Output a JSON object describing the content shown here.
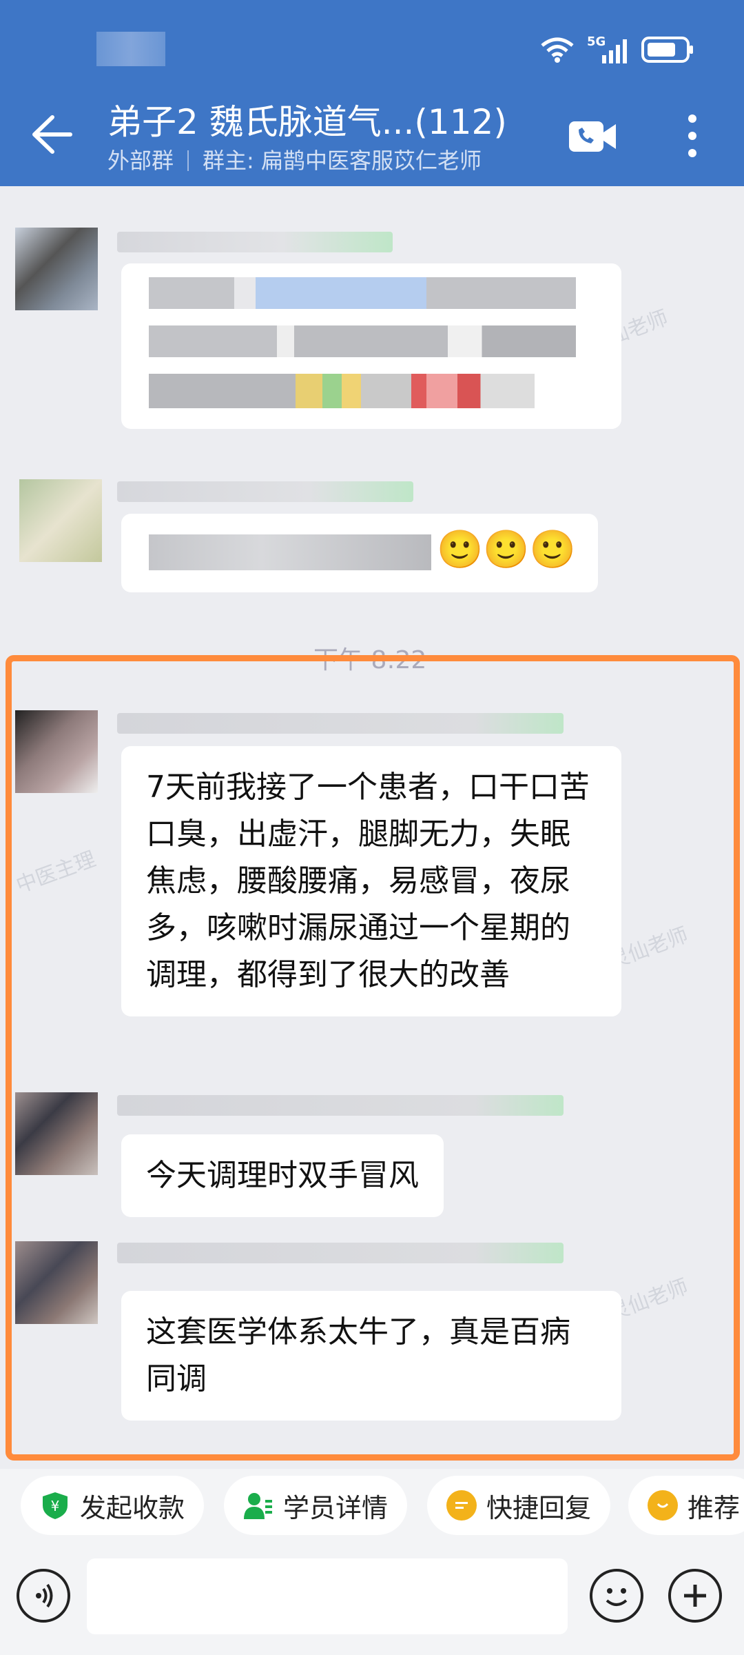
{
  "header": {
    "title": "弟子2  魏氏脉道气...(112)",
    "group_type": "外部群",
    "owner": "群主: 扁鹊中医客服苡仁老师",
    "network": "5G",
    "accent": "#3e76c6"
  },
  "chat": {
    "time_divider": "下午 8:22",
    "emoji": "🙂",
    "messages": [
      {
        "id": "m1",
        "text": "7天前我接了一个患者，口干口苦口臭，出虚汗，腿脚无力，失眠焦虑，腰酸腰痛，易感冒，夜尿多，咳嗽时漏尿通过一个星期的调理，都得到了很大的改善"
      },
      {
        "id": "m2",
        "text": "今天调理时双手冒风"
      },
      {
        "id": "m3",
        "text": "这套医学体系太牛了，真是百病同调"
      }
    ],
    "highlight_color": "#ff8b3c"
  },
  "quick_actions": [
    {
      "label": "发起收款",
      "icon": "payment-shield-icon",
      "color": "#1aad4b"
    },
    {
      "label": "学员详情",
      "icon": "student-profile-icon",
      "color": "#1aad4b"
    },
    {
      "label": "快捷回复",
      "icon": "quick-reply-icon",
      "color": "#f3b21a"
    },
    {
      "label": "推荐",
      "icon": "recommend-icon",
      "color": "#f3b21a"
    }
  ],
  "input_bar": {
    "placeholder": ""
  }
}
